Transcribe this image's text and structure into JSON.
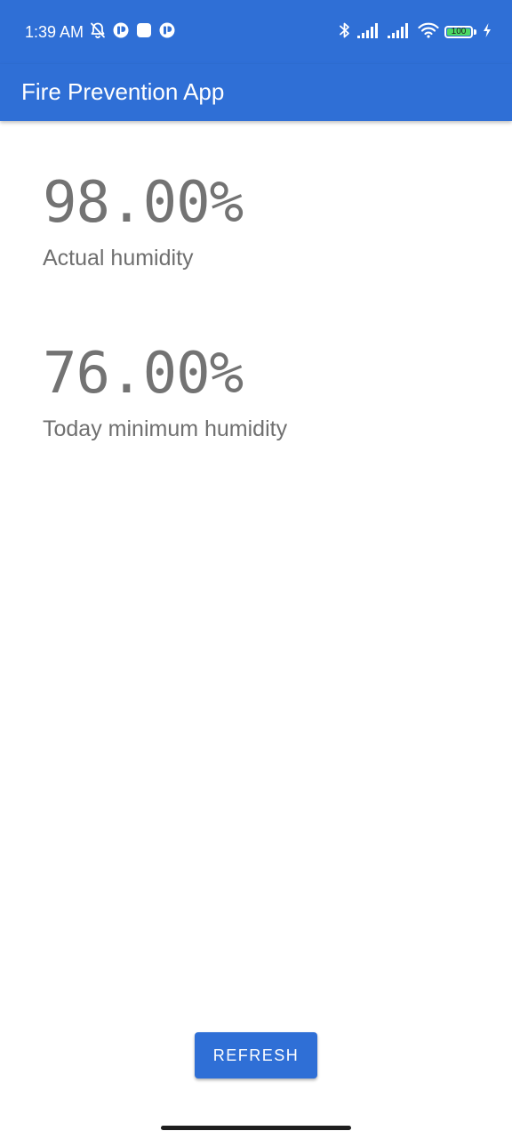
{
  "status_bar": {
    "time": "1:39 AM",
    "battery_level": "100",
    "battery_fraction": 1.0,
    "left_icons": [
      "bell-off-icon",
      "app-notification-icon",
      "square-notification-icon",
      "app-notification-icon"
    ],
    "right_icons": [
      "bluetooth-icon",
      "signal-icon",
      "signal-icon",
      "wifi-icon",
      "battery-icon",
      "charging-icon"
    ]
  },
  "app_bar": {
    "title": "Fire Prevention App",
    "color": "#2f6fd6"
  },
  "metrics": [
    {
      "value": "98.00%",
      "label": "Actual humidity"
    },
    {
      "value": "76.00%",
      "label": "Today minimum humidity"
    }
  ],
  "actions": {
    "refresh_label": "REFRESH"
  },
  "colors": {
    "accent": "#2f6fd6",
    "value_text": "#737373",
    "battery": "#4cd964"
  }
}
